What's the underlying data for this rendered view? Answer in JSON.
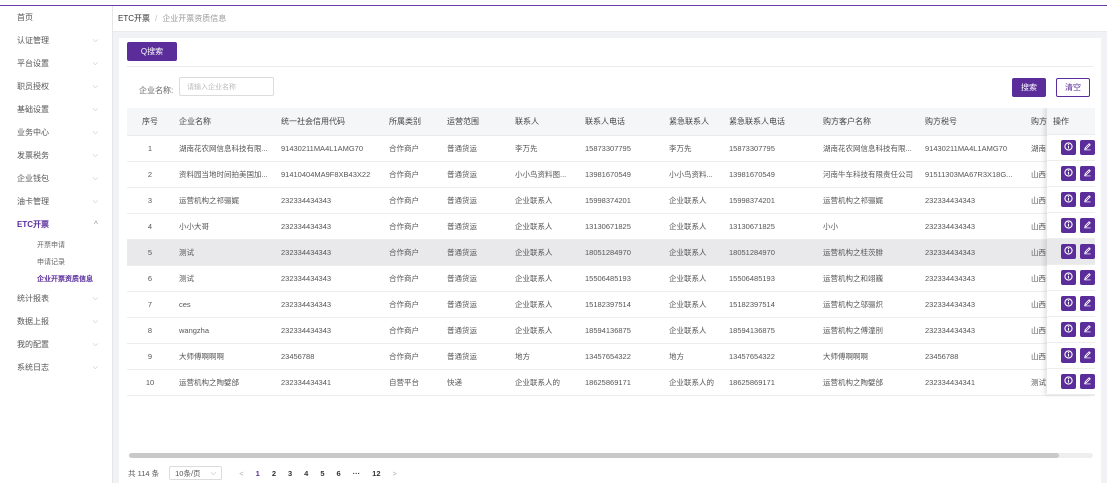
{
  "sidebar": {
    "items": [
      {
        "label": "首页",
        "chev": ""
      },
      {
        "label": "认证管理",
        "chev": "⌵"
      },
      {
        "label": "平台设置",
        "chev": "⌵"
      },
      {
        "label": "职员授权",
        "chev": "⌵"
      },
      {
        "label": "基础设置",
        "chev": "⌵"
      },
      {
        "label": "业务中心",
        "chev": "⌵"
      },
      {
        "label": "发票税务",
        "chev": "⌵"
      },
      {
        "label": "企业钱包",
        "chev": "⌵"
      },
      {
        "label": "油卡管理",
        "chev": "⌵"
      },
      {
        "label": "ETC开票",
        "chev": "^"
      }
    ],
    "sub_items": [
      "开票申请",
      "申请记录",
      "企业开票资质信息"
    ],
    "items_after": [
      {
        "label": "统计报表",
        "chev": "⌵"
      },
      {
        "label": "数据上报",
        "chev": "⌵"
      },
      {
        "label": "我的配置",
        "chev": "⌵"
      },
      {
        "label": "系统日志",
        "chev": "⌵"
      }
    ]
  },
  "breadcrumb": {
    "root": "ETC开票",
    "sep": "/",
    "current": "企业开票资质信息"
  },
  "search_tab": "Q搜索",
  "filter": {
    "label": "企业名称:",
    "placeholder": "请输入企业名称"
  },
  "buttons": {
    "search": "搜索",
    "clear": "清空"
  },
  "table": {
    "headers": [
      "序号",
      "企业名称",
      "统一社会信用代码",
      "所属类别",
      "运营范围",
      "联系人",
      "联系人电话",
      "紧急联系人",
      "紧急联系人电话",
      "购方客户名称",
      "购方税号",
      "购方"
    ],
    "op_header": "操作",
    "rows": [
      [
        "1",
        "湖南花农网信息科技有限...",
        "91430211MA4L1AMG70",
        "合作商户",
        "普通货运",
        "李万先",
        "15873307795",
        "李万先",
        "15873307795",
        "湖南花农网信息科技有限...",
        "91430211MA4L1AMG70",
        "湖南"
      ],
      [
        "2",
        "资料园当地时间拍美国加...",
        "91410404MA9F8XB43X22",
        "合作商户",
        "普通货运",
        "小小鸟资料图...",
        "13981670549",
        "小小鸟资料...",
        "13981670549",
        "河南牛车科技有限责任公司",
        "91511303MA67R3X18G...",
        "山西"
      ],
      [
        "3",
        "运营机构之祁骊娓",
        "232334434343",
        "合作商户",
        "普通货运",
        "企业联系人",
        "15998374201",
        "企业联系人",
        "15998374201",
        "运营机构之祁骊娓",
        "232334434343",
        "山西"
      ],
      [
        "4",
        "小小大哥",
        "232334434343",
        "合作商户",
        "普通货运",
        "企业联系人",
        "13130671825",
        "企业联系人",
        "13130671825",
        "小小",
        "232334434343",
        "山西"
      ],
      [
        "5",
        "测试",
        "232334434343",
        "合作商户",
        "普通货运",
        "企业联系人",
        "18051284970",
        "企业联系人",
        "18051284970",
        "运营机构之桂茨腓",
        "232334434343",
        "山西"
      ],
      [
        "6",
        "测试",
        "232334434343",
        "合作商户",
        "普通货运",
        "企业联系人",
        "15506485193",
        "企业联系人",
        "15506485193",
        "运营机构之和翊巍",
        "232334434343",
        "山西"
      ],
      [
        "7",
        "ces",
        "232334434343",
        "合作商户",
        "普通货运",
        "企业联系人",
        "15182397514",
        "企业联系人",
        "15182397514",
        "运营机构之邬骊炽",
        "232334434343",
        "山西"
      ],
      [
        "8",
        "wangzha",
        "232334434343",
        "合作商户",
        "普通货运",
        "企业联系人",
        "18594136875",
        "企业联系人",
        "18594136875",
        "运营机构之傅潼刖",
        "232334434343",
        "山西"
      ],
      [
        "9",
        "大师傅啊啊啊",
        "23456788",
        "合作商户",
        "普通货运",
        "地方",
        "13457654322",
        "地方",
        "13457654322",
        "大师傅啊啊啊",
        "23456788",
        "山西"
      ],
      [
        "10",
        "运营机构之陶嬖邰",
        "232334434341",
        "自营平台",
        "快递",
        "企业联系人的",
        "18625869171",
        "企业联系人的",
        "18625869171",
        "运营机构之陶嬖邰",
        "232334434341",
        "测试"
      ]
    ],
    "highlighted_row": 5
  },
  "pager": {
    "total": "共 114 条",
    "page_size": "10条/页",
    "size_chev": "⌵",
    "prev": "<",
    "pages": [
      "1",
      "2",
      "3",
      "4",
      "5",
      "6",
      "···",
      "12"
    ],
    "next": ">",
    "active": "1"
  },
  "icons": {
    "info": "info-icon",
    "edit": "edit-icon"
  },
  "colors": {
    "accent": "#5a2d9a",
    "highlight_row": "#e9e9eb"
  }
}
